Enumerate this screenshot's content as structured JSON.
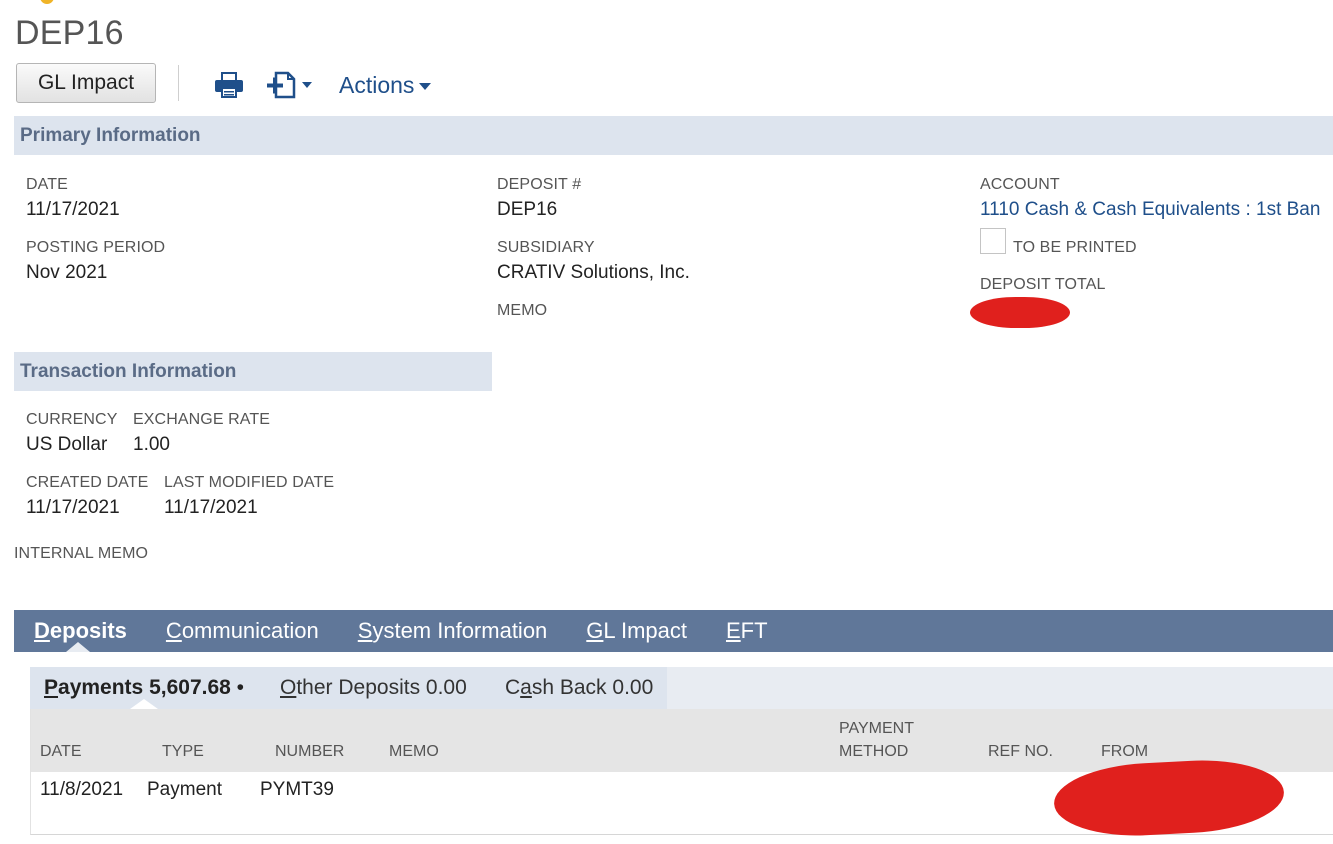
{
  "record": {
    "title": "DEP16"
  },
  "toolbar": {
    "gl_impact_label": "GL Impact",
    "actions_label": "Actions"
  },
  "primary": {
    "section_title": "Primary Information",
    "date_label": "DATE",
    "date_value": "11/17/2021",
    "posting_period_label": "POSTING PERIOD",
    "posting_period_value": "Nov 2021",
    "deposit_no_label": "DEPOSIT #",
    "deposit_no_value": "DEP16",
    "subsidiary_label": "SUBSIDIARY",
    "subsidiary_value": "CRATIV Solutions, Inc.",
    "memo_label": "MEMO",
    "account_label": "ACCOUNT",
    "account_value": "1110 Cash & Cash Equivalents : 1st Ban",
    "to_be_printed_label": "TO BE PRINTED",
    "deposit_total_label": "DEPOSIT TOTAL"
  },
  "transaction": {
    "section_title": "Transaction Information",
    "currency_label": "CURRENCY",
    "currency_value": "US Dollar",
    "exchange_rate_label": "EXCHANGE RATE",
    "exchange_rate_value": "1.00",
    "created_date_label": "CREATED DATE",
    "created_date_value": "11/17/2021",
    "last_modified_label": "LAST MODIFIED DATE",
    "last_modified_value": "11/17/2021",
    "internal_memo_label": "INTERNAL MEMO"
  },
  "tabs": {
    "deposits": {
      "first": "D",
      "rest": "eposits"
    },
    "communication": {
      "first": "C",
      "rest": "ommunication"
    },
    "system_information": {
      "first": "S",
      "rest": "ystem Information"
    },
    "gl_impact": {
      "first": "G",
      "rest": "L Impact"
    },
    "eft": {
      "first": "E",
      "rest": "FT"
    }
  },
  "subtabs": {
    "payments": {
      "first": "P",
      "rest": "ayments",
      "amount": "5,607.68",
      "bullet": "•"
    },
    "other_deposits": {
      "first": "O",
      "rest": "ther Deposits",
      "amount": "0.00"
    },
    "cash_back": {
      "pre": "C",
      "key": "a",
      "rest": "sh Back",
      "amount": "0.00"
    }
  },
  "payments_table": {
    "headers": {
      "date": "DATE",
      "type": "TYPE",
      "number": "NUMBER",
      "memo": "MEMO",
      "payment_method_line1": "PAYMENT",
      "payment_method_line2": "METHOD",
      "ref_no": "REF NO.",
      "from": "FROM"
    },
    "rows": [
      {
        "date": "11/8/2021",
        "type": "Payment",
        "number": "PYMT39"
      }
    ]
  },
  "icons": {
    "print": "print-icon",
    "new_document": "new-document-icon",
    "dropdown": "chevron-down-icon"
  },
  "colors": {
    "link": "#1f4f8a",
    "section_header_bg": "#dde4ee",
    "section_header_text": "#5a6b86",
    "tab_bar_bg": "#607799",
    "redaction": "#e0201d"
  }
}
